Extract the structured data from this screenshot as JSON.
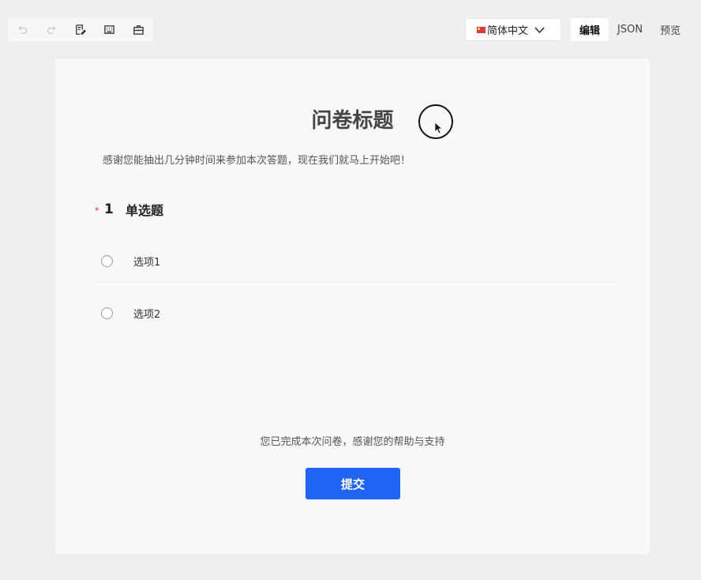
{
  "toolbar": {
    "items": [
      {
        "icon": "undo-icon",
        "enabled": false
      },
      {
        "icon": "redo-icon",
        "enabled": false
      },
      {
        "icon": "edit-note-icon",
        "enabled": true
      },
      {
        "icon": "keyboard-icon",
        "enabled": true
      },
      {
        "icon": "briefcase-icon",
        "enabled": true
      }
    ]
  },
  "language": {
    "flag_icon": "china-flag-icon",
    "selected": "简体中文"
  },
  "mode_tabs": [
    {
      "label": "编辑",
      "active": true
    },
    {
      "label": "JSON",
      "active": false
    },
    {
      "label": "预览",
      "active": false
    }
  ],
  "survey": {
    "title": "问卷标题",
    "description": "感谢您能抽出几分钟时间来参加本次答题，现在我们就马上开始吧！",
    "questions": [
      {
        "required_mark": "*",
        "number": "1",
        "title": "单选题",
        "options": [
          "选项1",
          "选项2"
        ]
      }
    ],
    "finish_text": "您已完成本次问卷，感谢您的帮助与支持",
    "submit_label": "提交"
  },
  "colors": {
    "primary": "#1f64f2",
    "required": "#e02c2c",
    "background": "#efeff0"
  }
}
